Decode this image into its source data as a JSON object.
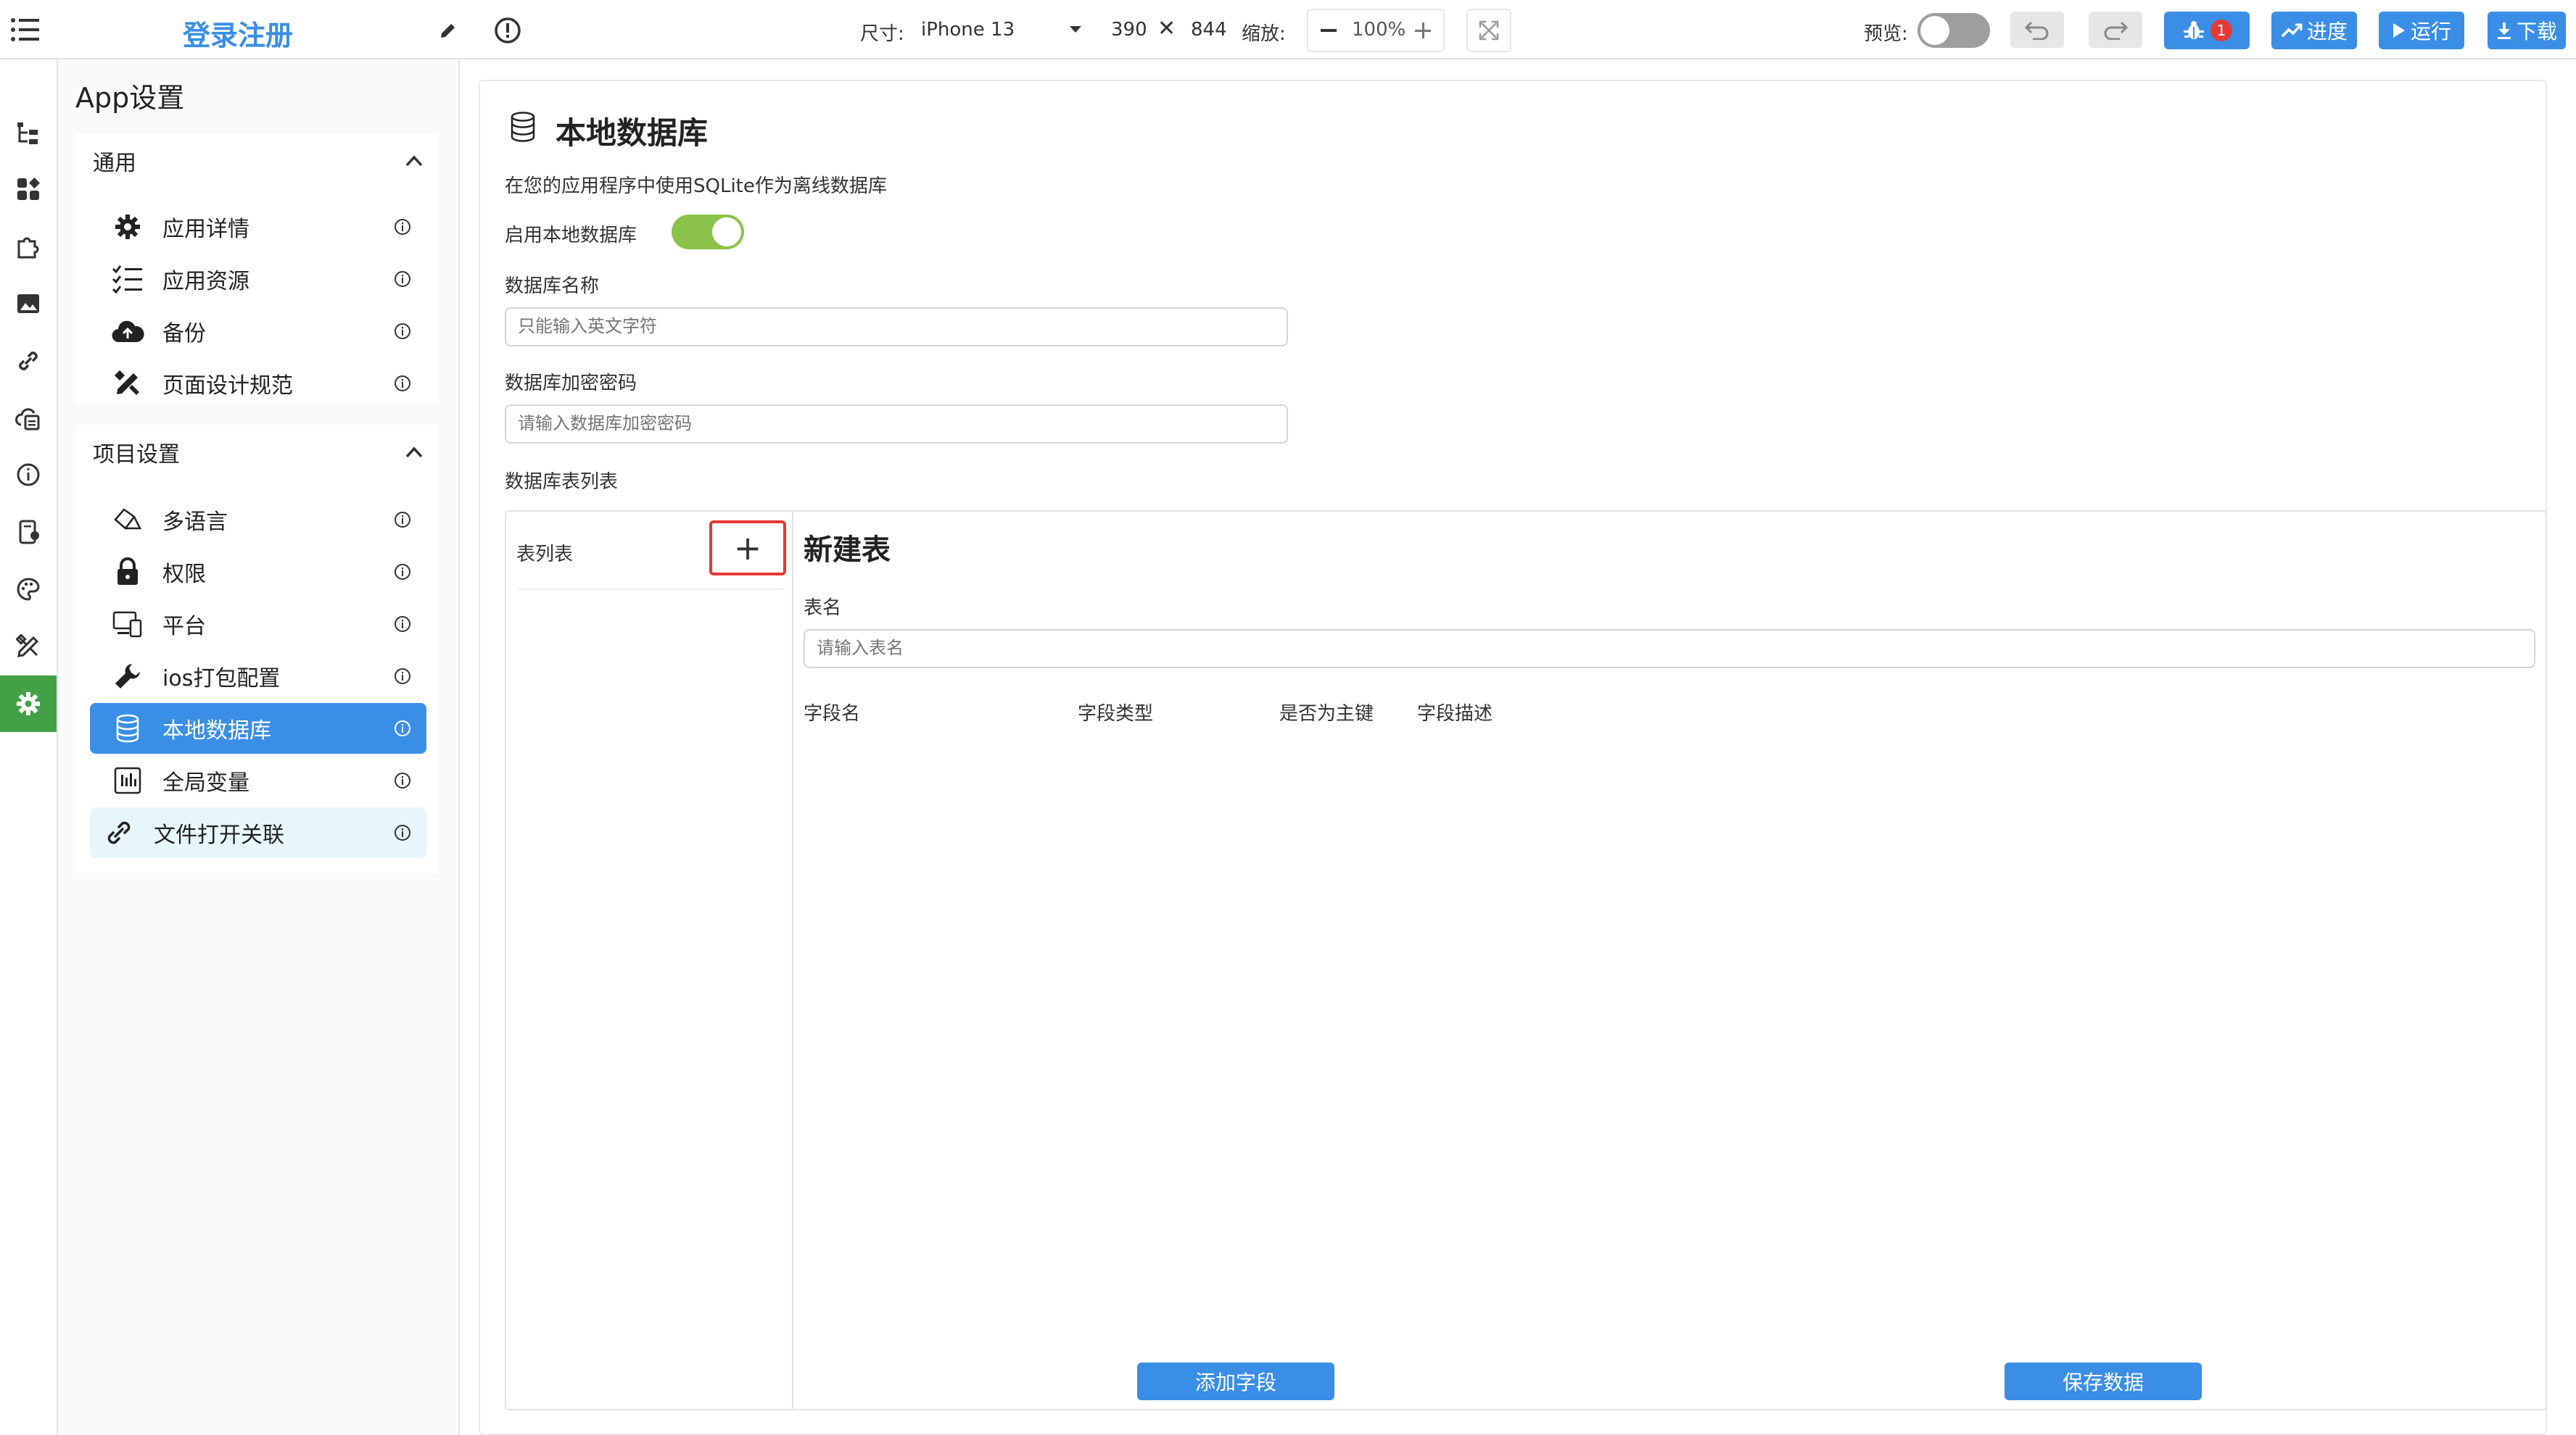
{
  "topbar": {
    "project_title": "登录注册",
    "size_label": "尺寸:",
    "device": "iPhone 13",
    "width_value": "390",
    "times": "✕",
    "height_value": "844",
    "zoom_label": "缩放:",
    "zoom_value": "100%",
    "preview_label": "预览:",
    "debug_badge": "1",
    "progress_label": "进度",
    "run_label": "运行",
    "download_label": "下载"
  },
  "panel": {
    "title": "App设置",
    "sections": [
      {
        "title": "通用",
        "items": [
          {
            "label": "应用详情"
          },
          {
            "label": "应用资源"
          },
          {
            "label": "备份"
          },
          {
            "label": "页面设计规范"
          }
        ]
      },
      {
        "title": "项目设置",
        "items": [
          {
            "label": "多语言"
          },
          {
            "label": "权限"
          },
          {
            "label": "平台"
          },
          {
            "label": "ios打包配置"
          },
          {
            "label": "本地数据库"
          },
          {
            "label": "全局变量"
          },
          {
            "label": "文件打开关联"
          }
        ]
      }
    ]
  },
  "main": {
    "title": "本地数据库",
    "description": "在您的应用程序中使用SQLite作为离线数据库",
    "enable_label": "启用本地数据库",
    "db_name_label": "数据库名称",
    "db_name_placeholder": "只能输入英文字符",
    "db_password_label": "数据库加密密码",
    "db_password_placeholder": "请输入数据库加密密码",
    "table_list_label": "数据库表列表",
    "table_list_header": "表列表",
    "add_symbol": "+",
    "new_table_title": "新建表",
    "table_name_label": "表名",
    "table_name_placeholder": "请输入表名",
    "columns": [
      "字段名",
      "字段类型",
      "是否为主键",
      "字段描述"
    ],
    "add_field_button": "添加字段",
    "save_button": "保存数据"
  },
  "colors": {
    "accent": "#3a8ee6",
    "active_rail": "#43a047",
    "switch_on": "#8bc34a",
    "highlight_box": "#e53935",
    "badge": "#e53935"
  }
}
